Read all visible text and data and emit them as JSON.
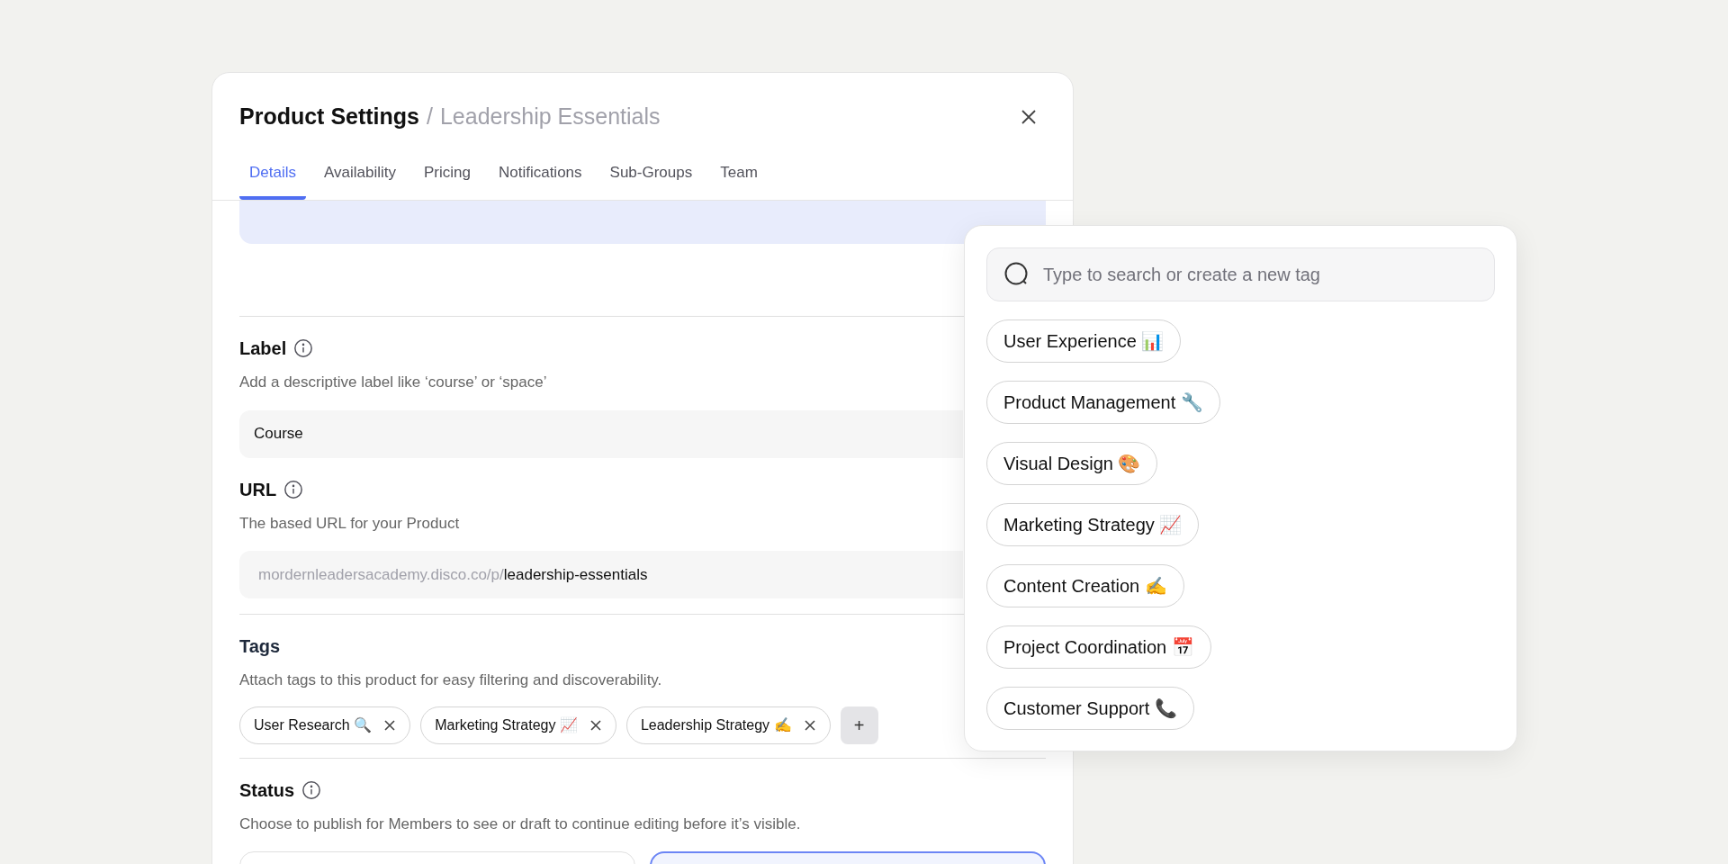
{
  "modal": {
    "title": "Product Settings",
    "separator": "/",
    "subtitle": "Leadership Essentials"
  },
  "tabs": [
    {
      "label": "Details",
      "selected": true
    },
    {
      "label": "Availability",
      "selected": false
    },
    {
      "label": "Pricing",
      "selected": false
    },
    {
      "label": "Notifications",
      "selected": false
    },
    {
      "label": "Sub-Groups",
      "selected": false
    },
    {
      "label": "Team",
      "selected": false
    }
  ],
  "label_field": {
    "title": "Label",
    "description": "Add a descriptive label like ‘course’ or ‘space’",
    "value": "Course"
  },
  "url_field": {
    "title": "URL",
    "description": "The based URL for your Product",
    "prefix": "mordernleadersacademy.disco.co/p/",
    "value": "leadership-essentials"
  },
  "tags": {
    "title": "Tags",
    "description": "Attach tags to this product for easy filtering and discoverability.",
    "items": [
      "User Research 🔍",
      "Marketing Strategy 📈",
      "Leadership Strategy ✍️"
    ],
    "add": "+"
  },
  "status": {
    "title": "Status",
    "description": "Choose to publish for Members to see or draft to continue editing before it’s visible.",
    "options": [
      {
        "selected": false
      },
      {
        "selected": true
      }
    ]
  },
  "tag_menu": {
    "placeholder": "Type to search or create a new tag",
    "options": [
      "User Experience 📊",
      "Product Management 🔧",
      "Visual Design 🎨",
      "Marketing Strategy 📈",
      "Content Creation ✍️",
      "Project Coordination 📅",
      "Customer Support 📞"
    ]
  }
}
